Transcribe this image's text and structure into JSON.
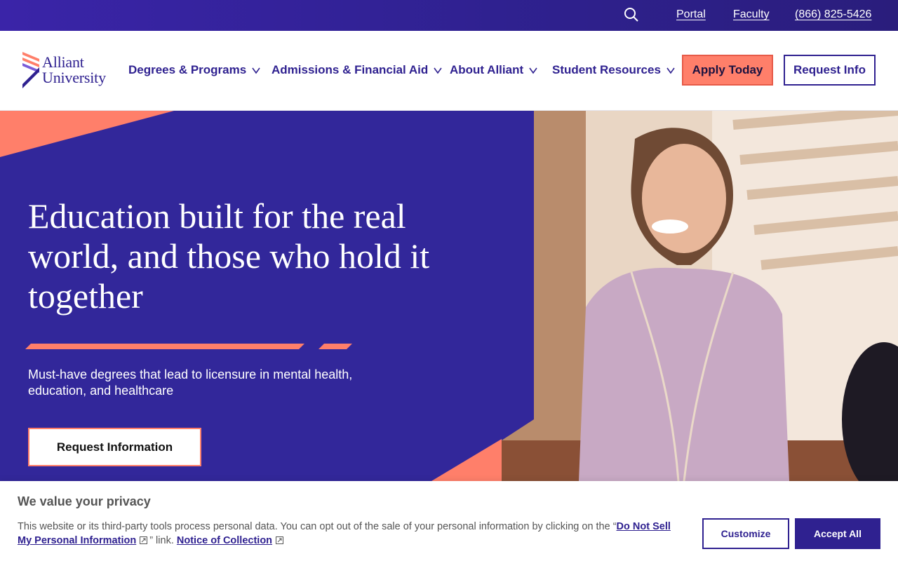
{
  "utility": {
    "search_icon": "search-icon",
    "links": [
      "Portal",
      "Faculty",
      "(866) 825-5426"
    ]
  },
  "header": {
    "logo": {
      "line1": "Alliant",
      "line2": "University"
    },
    "nav": [
      {
        "label": "Degrees & Programs"
      },
      {
        "label": "Admissions & Financial Aid"
      },
      {
        "label": "About Alliant"
      },
      {
        "label": "Student Resources"
      }
    ],
    "apply_label": "Apply Today",
    "info_label": "Request Info"
  },
  "hero": {
    "title": "Education built for the real world, and those who hold it together",
    "subtitle": "Must-have degrees that lead to licensure in mental health, education, and healthcare",
    "cta_label": "Request Information"
  },
  "cookie": {
    "title": "We value your privacy",
    "text_before": "This website or its third-party tools process personal data. You can opt out of the sale of your personal information by clicking on the “",
    "link1": "Do Not Sell My Personal Information",
    "text_middle": "” link.",
    "link2": "Notice of Collection",
    "customize_label": "Customize",
    "accept_label": "Accept All"
  },
  "colors": {
    "brand_purple": "#2f2190",
    "coral": "#ff7f6a",
    "hero_bg": "#32279a"
  }
}
